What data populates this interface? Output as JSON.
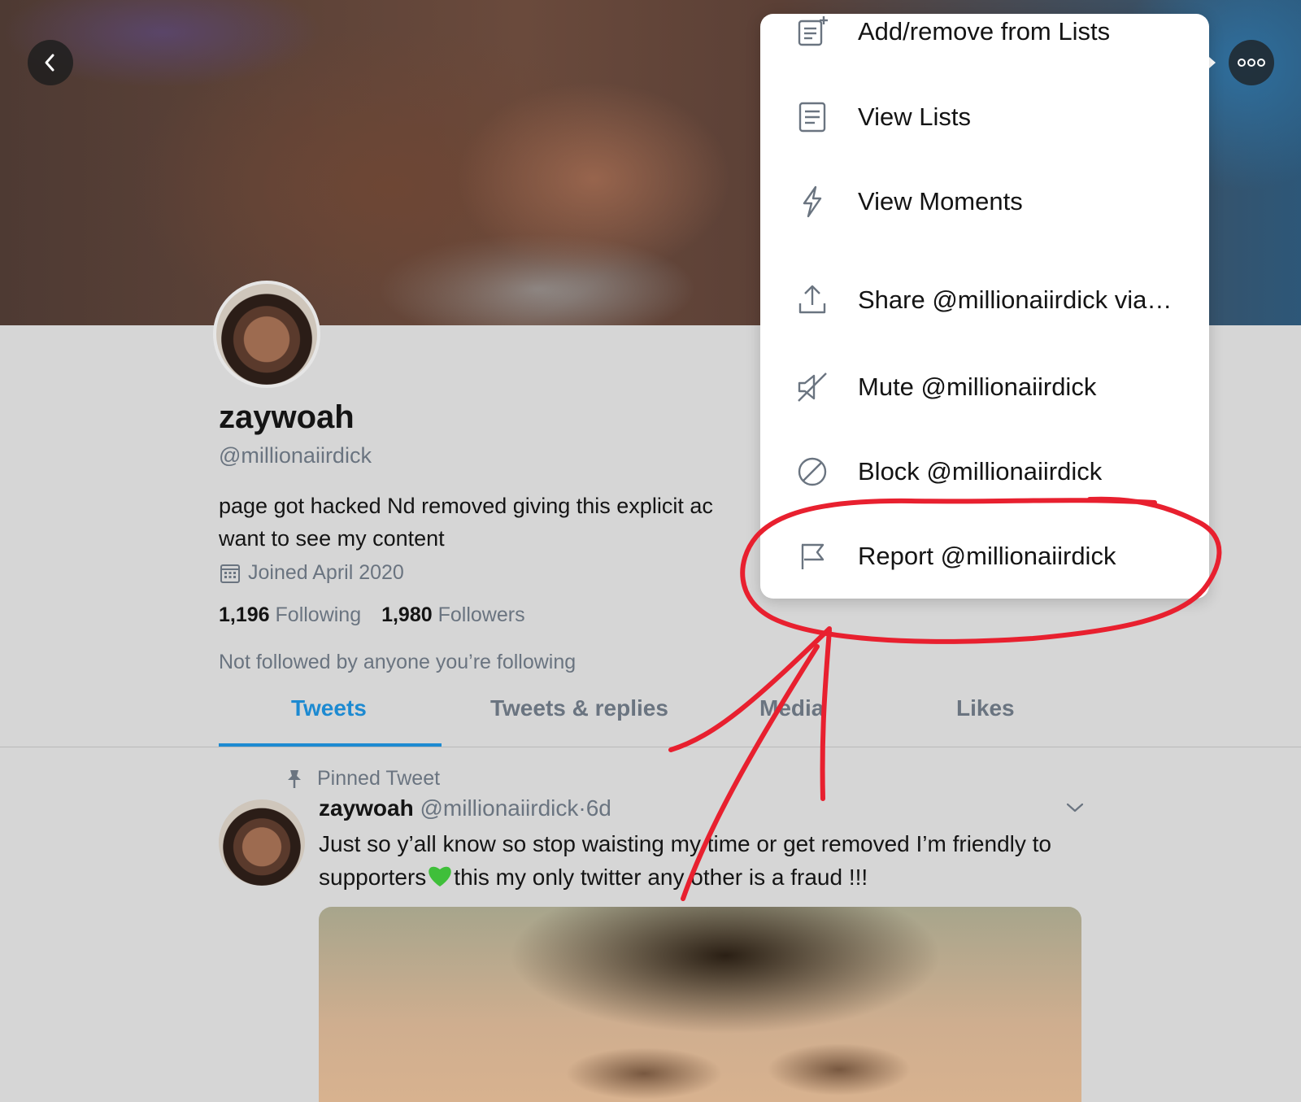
{
  "header": {
    "back_icon": "chevron-left-icon",
    "more_icon": "more-dots-icon"
  },
  "profile": {
    "display_name": "zaywoah",
    "handle": "@millionaiirdick",
    "bio": "page got hacked Nd removed giving this explicit ac want to see my content",
    "joined": "Joined April 2020",
    "following_count": "1,196",
    "following_label": "Following",
    "followers_count": "1,980",
    "followers_label": "Followers",
    "not_followed": "Not followed by anyone you’re following"
  },
  "tabs": [
    {
      "label": "Tweets",
      "active": true
    },
    {
      "label": "Tweets & replies",
      "active": false
    },
    {
      "label": "Media",
      "active": false
    },
    {
      "label": "Likes",
      "active": false
    }
  ],
  "pinned_tweet": {
    "pinned_label": "Pinned Tweet",
    "name": "zaywoah",
    "handle": "@millionaiirdick",
    "separator": "·",
    "time": "6d",
    "text_before_emoji": "Just so y’all know so stop waisting my time or get removed I’m friendly to supporters",
    "emoji": "💚",
    "text_after_emoji": "this my only twitter any other is a fraud !!!"
  },
  "menu": {
    "items": [
      {
        "label": "Add/remove from Lists",
        "icon": "list-add-icon"
      },
      {
        "label": "View Lists",
        "icon": "list-icon"
      },
      {
        "label": "View Moments",
        "icon": "lightning-icon"
      },
      {
        "label": "Share @millionaiirdick via…",
        "icon": "share-icon"
      },
      {
        "label": "Mute @millionaiirdick",
        "icon": "mute-icon"
      },
      {
        "label": "Block @millionaiirdick",
        "icon": "block-icon"
      },
      {
        "label": "Report @millionaiirdick",
        "icon": "flag-icon"
      }
    ]
  },
  "colors": {
    "accent": "#1d8ad1",
    "annotation": "#e8202f",
    "muted_text": "#6a7480"
  }
}
